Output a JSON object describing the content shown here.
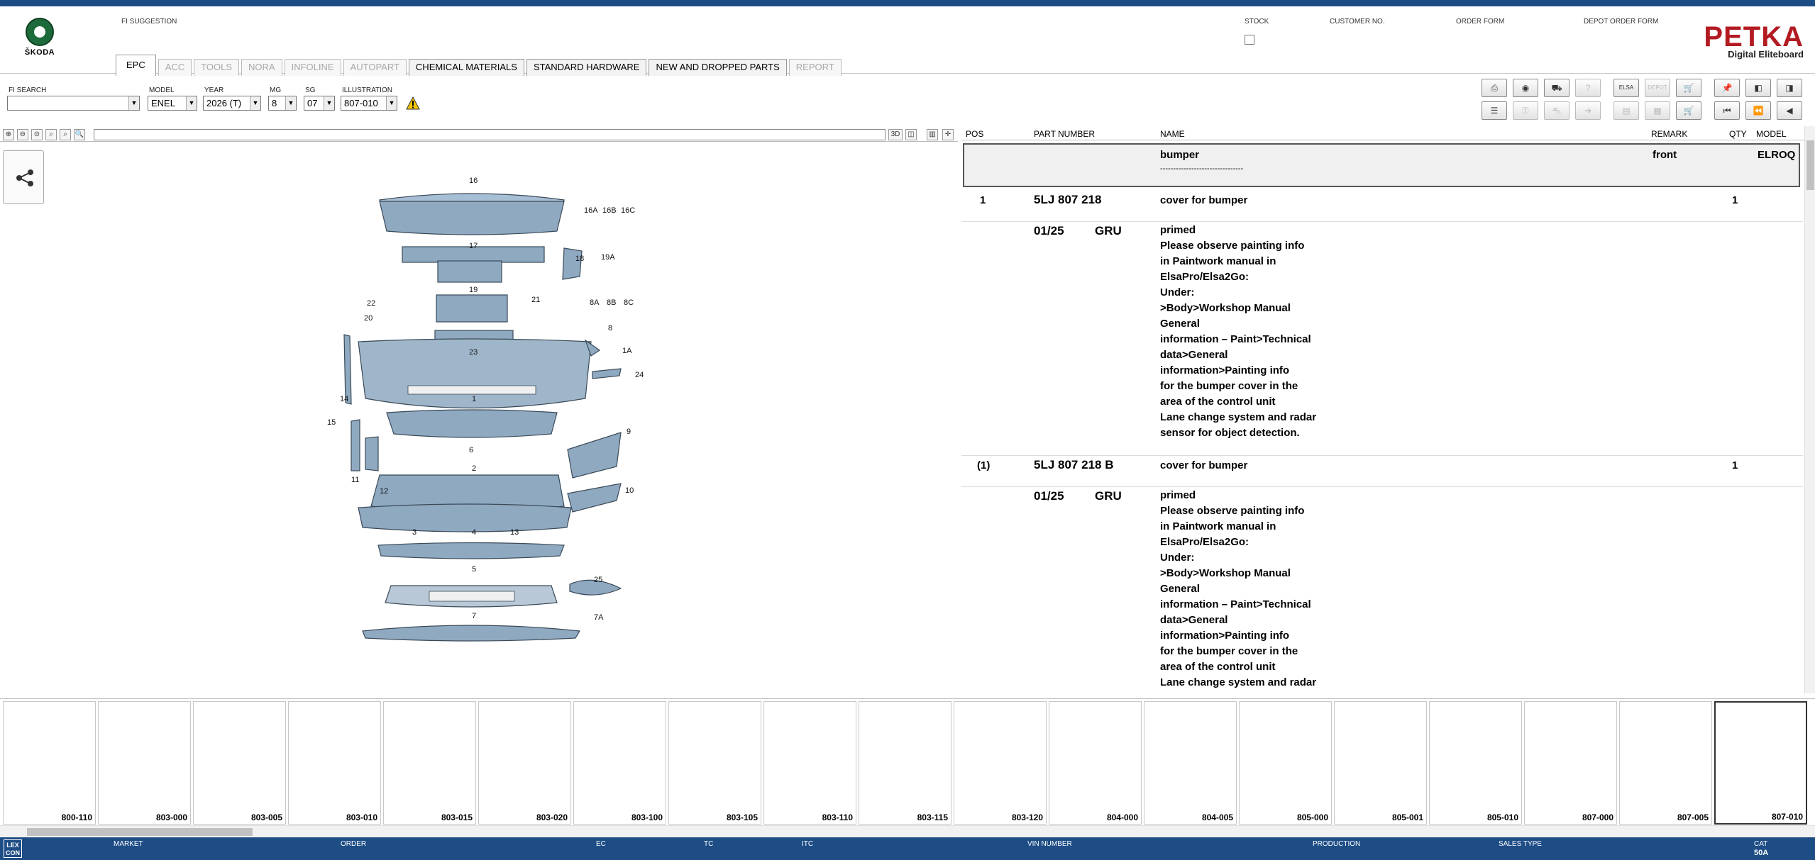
{
  "header": {
    "brand": "ŠKODA",
    "fi_suggestion_label": "FI SUGGESTION",
    "stock_label": "STOCK",
    "customer_no_label": "CUSTOMER NO.",
    "order_form_label": "ORDER FORM",
    "depot_order_form_label": "DEPOT ORDER FORM",
    "petka_title": "PETKA",
    "petka_subtitle": "Digital Eliteboard"
  },
  "tabs": [
    {
      "label": "EPC",
      "state": "active"
    },
    {
      "label": "ACC",
      "state": "disabled"
    },
    {
      "label": "TOOLS",
      "state": "disabled"
    },
    {
      "label": "NORA",
      "state": "disabled"
    },
    {
      "label": "INFOLINE",
      "state": "disabled"
    },
    {
      "label": "AUTOPART",
      "state": "disabled"
    },
    {
      "label": "CHEMICAL MATERIALS",
      "state": "enabled"
    },
    {
      "label": "STANDARD HARDWARE",
      "state": "enabled"
    },
    {
      "label": "NEW AND DROPPED PARTS",
      "state": "enabled"
    },
    {
      "label": "REPORT",
      "state": "disabled"
    }
  ],
  "filters": {
    "fi_search_label": "FI SEARCH",
    "fi_search_value": "",
    "model_label": "MODEL",
    "model_value": "ENEL",
    "year_label": "YEAR",
    "year_value": "2026 (T)",
    "mg_label": "MG",
    "mg_value": "8",
    "sg_label": "SG",
    "sg_value": "07",
    "illustration_label": "ILLUSTRATION",
    "illustration_value": "807-010"
  },
  "toolbar_icons": {
    "row1": [
      "print-icon",
      "camera-icon",
      "car-icon",
      "help-icon",
      "elsa-icon",
      "depot-icon",
      "cart-icon",
      "pin-icon",
      "prev-page-icon",
      "next-page-icon"
    ],
    "row1_labels": [
      "",
      "",
      "",
      "",
      "ELSA",
      "DEPOT",
      "",
      "",
      "",
      ""
    ],
    "row2": [
      "list-icon",
      "key-icon",
      "vehicle-icon",
      "arrow-icon",
      "doc-icon",
      "stamp-icon",
      "order-cart-icon",
      "first-icon",
      "previous-icon",
      "back-icon"
    ],
    "row2_disabled": [
      false,
      true,
      true,
      true,
      true,
      true,
      false,
      false,
      false,
      false
    ]
  },
  "viewer": {
    "mode_3d": "3D"
  },
  "callouts": [
    {
      "label": "16"
    },
    {
      "label": "16A"
    },
    {
      "label": "16B"
    },
    {
      "label": "16C"
    },
    {
      "label": "17"
    },
    {
      "label": "18"
    },
    {
      "label": "19A"
    },
    {
      "label": "19"
    },
    {
      "label": "21"
    },
    {
      "label": "22"
    },
    {
      "label": "20"
    },
    {
      "label": "8A"
    },
    {
      "label": "8B"
    },
    {
      "label": "8C"
    },
    {
      "label": "8"
    },
    {
      "label": "23"
    },
    {
      "label": "1A"
    },
    {
      "label": "24"
    },
    {
      "label": "14"
    },
    {
      "label": "1"
    },
    {
      "label": "15"
    },
    {
      "label": "9"
    },
    {
      "label": "6"
    },
    {
      "label": "11"
    },
    {
      "label": "2"
    },
    {
      "label": "12"
    },
    {
      "label": "10"
    },
    {
      "label": "3"
    },
    {
      "label": "4"
    },
    {
      "label": "13"
    },
    {
      "label": "5"
    },
    {
      "label": "25"
    },
    {
      "label": "7A"
    },
    {
      "label": "7"
    }
  ],
  "parts_table": {
    "columns": {
      "pos": "POS",
      "part_number": "PART NUMBER",
      "name": "NAME",
      "remark": "REMARK",
      "qty": "QTY",
      "model": "MODEL"
    },
    "group": {
      "name": "bumper",
      "remark": "front",
      "model": "ELROQ",
      "separator": "--------------------------------"
    },
    "rows": [
      {
        "pos": "1",
        "part_number": "5LJ 807 218",
        "name": "cover for bumper",
        "qty": "1",
        "date": "01/25",
        "code": "GRU",
        "notes": [
          "primed",
          "Please observe painting info",
          "in Paintwork manual in",
          "ElsaPro/Elsa2Go:",
          "Under:",
          ">Body>Workshop Manual",
          "General",
          "information – Paint>Technical",
          "data>General",
          "information>Painting info",
          "for the bumper cover in the",
          "area of the control unit",
          "Lane change system and radar",
          "sensor for object detection."
        ]
      },
      {
        "pos": "(1)",
        "part_number": "5LJ 807 218 B",
        "name": "cover for bumper",
        "qty": "1",
        "date": "01/25",
        "code": "GRU",
        "notes": [
          "primed",
          "Please observe painting info",
          "in Paintwork manual in",
          "ElsaPro/Elsa2Go:",
          "Under:",
          ">Body>Workshop Manual",
          "General",
          "information – Paint>Technical",
          "data>General",
          "information>Painting info",
          "for the bumper cover in the",
          "area of the control unit",
          "Lane change system and radar"
        ]
      }
    ]
  },
  "thumbnails": [
    "800-110",
    "803-000",
    "803-005",
    "803-010",
    "803-015",
    "803-020",
    "803-100",
    "803-105",
    "803-110",
    "803-115",
    "803-120",
    "804-000",
    "804-005",
    "805-000",
    "805-001",
    "805-010",
    "807-000",
    "807-005",
    "807-010"
  ],
  "selected_thumbnail": "807-010",
  "status_bar": {
    "lex": "LEX\nCON",
    "market": "MARKET",
    "order": "ORDER",
    "ec": "EC",
    "tc": "TC",
    "itc": "ITC",
    "vin": "VIN NUMBER",
    "production": "PRODUCTION",
    "sales_type": "SALES TYPE",
    "cat_label": "CAT",
    "cat_value": "50A"
  },
  "colors": {
    "brand_blue": "#1e4d86",
    "petka_red": "#b31b22",
    "skoda_green": "#1d6b3a"
  }
}
